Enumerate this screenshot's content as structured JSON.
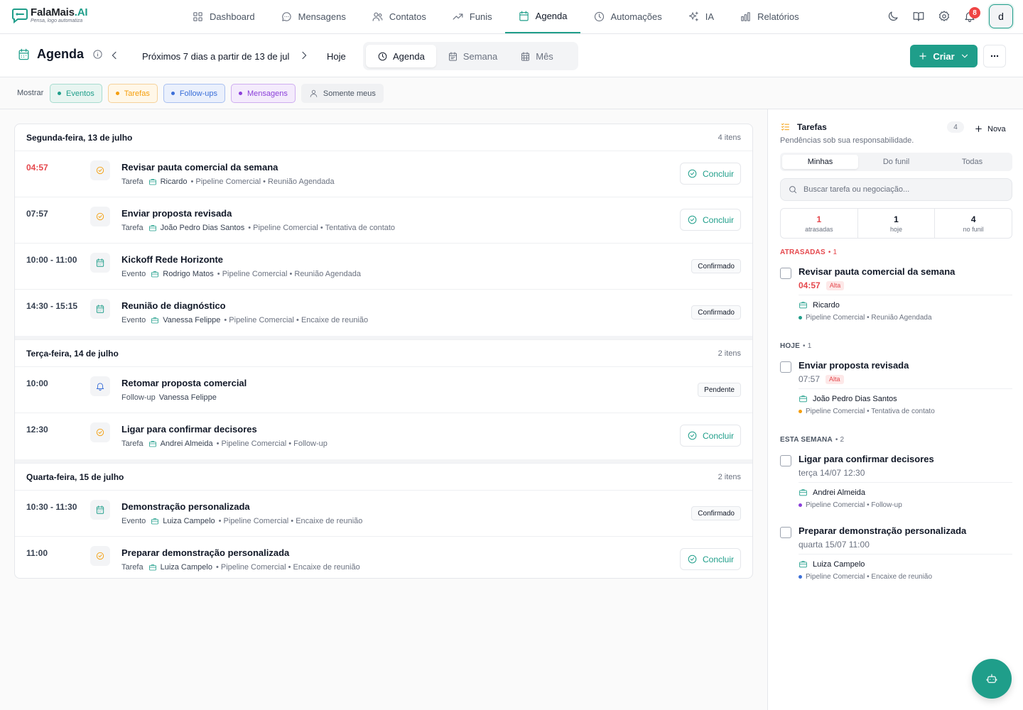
{
  "app": {
    "name": "FalaMais",
    "name_suffix": ".AI",
    "tagline": "Pensa, logo automatiza",
    "accent": "#1f9e8a"
  },
  "nav": [
    {
      "label": "Dashboard",
      "icon": "grid-icon",
      "active": false
    },
    {
      "label": "Mensagens",
      "icon": "chat-icon",
      "active": false
    },
    {
      "label": "Contatos",
      "icon": "users-icon",
      "active": false
    },
    {
      "label": "Funis",
      "icon": "trend-icon",
      "active": false
    },
    {
      "label": "Agenda",
      "icon": "calendar-icon",
      "active": true
    },
    {
      "label": "Automações",
      "icon": "clock-icon",
      "active": false
    },
    {
      "label": "IA",
      "icon": "sparkles-icon",
      "active": false
    },
    {
      "label": "Relatórios",
      "icon": "bar-chart-icon",
      "active": false
    }
  ],
  "top": {
    "notifications": "8",
    "avatar_letter": "d"
  },
  "header": {
    "title": "Agenda",
    "range": "Próximos 7 dias a partir de 13 de jul",
    "today": "Hoje",
    "views": [
      "Agenda",
      "Semana",
      "Mês"
    ],
    "create": "Criar"
  },
  "filters": {
    "label": "Mostrar",
    "chips": [
      {
        "label": "Eventos",
        "color": "#1f9e8a",
        "bg": "#e8f5f1",
        "border": "#a7dccf"
      },
      {
        "label": "Tarefas",
        "color": "#f59e0b",
        "bg": "#fff7e8",
        "border": "#f6d29a"
      },
      {
        "label": "Follow-ups",
        "color": "#3b6fd8",
        "bg": "#eaf0fc",
        "border": "#a9c0f0"
      },
      {
        "label": "Mensagens",
        "color": "#8b3fd9",
        "bg": "#f4ebfc",
        "border": "#cfaef0"
      }
    ],
    "mine": "Somente meus"
  },
  "days": [
    {
      "title": "Segunda-feira, 13 de julho",
      "count": "4 itens",
      "items": [
        {
          "time": "04:57",
          "late": true,
          "kind": "task",
          "title": "Revisar pauta comercial da semana",
          "type": "Tarefa",
          "who": "Ricardo",
          "path": "• Pipeline Comercial • Reunião Agendada",
          "action": "Concluir"
        },
        {
          "time": "07:57",
          "late": false,
          "kind": "task",
          "title": "Enviar proposta revisada",
          "type": "Tarefa",
          "who": "João Pedro Dias Santos",
          "path": "• Pipeline Comercial • Tentativa de contato",
          "action": "Concluir"
        },
        {
          "time": "10:00 - 11:00",
          "late": false,
          "kind": "event",
          "title": "Kickoff Rede Horizonte",
          "type": "Evento",
          "who": "Rodrigo Matos",
          "path": "• Pipeline Comercial • Reunião Agendada",
          "status": "Confirmado"
        },
        {
          "time": "14:30 - 15:15",
          "late": false,
          "kind": "event",
          "title": "Reunião de diagnóstico",
          "type": "Evento",
          "who": "Vanessa Felippe",
          "path": "• Pipeline Comercial • Encaixe de reunião",
          "status": "Confirmado"
        }
      ]
    },
    {
      "title": "Terça-feira, 14 de julho",
      "count": "2 itens",
      "items": [
        {
          "time": "10:00",
          "late": false,
          "kind": "followup",
          "title": "Retomar proposta comercial",
          "type": "Follow-up",
          "who": "Vanessa Felippe",
          "path": "",
          "status": "Pendente"
        },
        {
          "time": "12:30",
          "late": false,
          "kind": "task",
          "title": "Ligar para confirmar decisores",
          "type": "Tarefa",
          "who": "Andrei Almeida",
          "path": "• Pipeline Comercial • Follow-up",
          "action": "Concluir"
        }
      ]
    },
    {
      "title": "Quarta-feira, 15 de julho",
      "count": "2 itens",
      "items": [
        {
          "time": "10:30 - 11:30",
          "late": false,
          "kind": "event",
          "title": "Demonstração personalizada",
          "type": "Evento",
          "who": "Luiza Campelo",
          "path": "• Pipeline Comercial • Encaixe de reunião",
          "status": "Confirmado"
        },
        {
          "time": "11:00",
          "late": false,
          "kind": "task",
          "title": "Preparar demonstração personalizada",
          "type": "Tarefa",
          "who": "Luiza Campelo",
          "path": "• Pipeline Comercial • Encaixe de reunião",
          "action": "Concluir"
        }
      ]
    }
  ],
  "panel": {
    "title": "Tarefas",
    "subtitle": "Pendências sob sua responsabilidade.",
    "count": "4",
    "new": "Nova",
    "tabs": [
      "Minhas",
      "Do funil",
      "Todas"
    ],
    "search_placeholder": "Buscar tarefa ou negociação...",
    "stats": [
      {
        "n": "1",
        "l": "atrasadas"
      },
      {
        "n": "1",
        "l": "hoje"
      },
      {
        "n": "4",
        "l": "no funil"
      }
    ],
    "sections": [
      {
        "label": "ATRASADAS",
        "count": "• 1",
        "late": true,
        "tasks": [
          {
            "title": "Revisar pauta comercial da semana",
            "when": "04:57",
            "late": true,
            "priority": "Alta",
            "deal": "Ricardo",
            "pipe": "Pipeline Comercial • Reunião Agendada",
            "dot": "#1f9e8a"
          }
        ]
      },
      {
        "label": "HOJE",
        "count": "• 1",
        "late": false,
        "tasks": [
          {
            "title": "Enviar proposta revisada",
            "when": "07:57",
            "late": false,
            "priority": "Alta",
            "deal": "João Pedro Dias Santos",
            "pipe": "Pipeline Comercial • Tentativa de contato",
            "dot": "#f59e0b"
          }
        ]
      },
      {
        "label": "ESTA SEMANA",
        "count": "• 2",
        "late": false,
        "tasks": [
          {
            "title": "Ligar para confirmar decisores",
            "when": "terça 14/07 12:30",
            "late": false,
            "priority": "",
            "deal": "Andrei Almeida",
            "pipe": "Pipeline Comercial • Follow-up",
            "dot": "#8b3fd9"
          },
          {
            "title": "Preparar demonstração personalizada",
            "when": "quarta 15/07 11:00",
            "late": false,
            "priority": "",
            "deal": "Luiza Campelo",
            "pipe": "Pipeline Comercial • Encaixe de reunião",
            "dot": "#3b6fd8"
          }
        ]
      }
    ]
  }
}
